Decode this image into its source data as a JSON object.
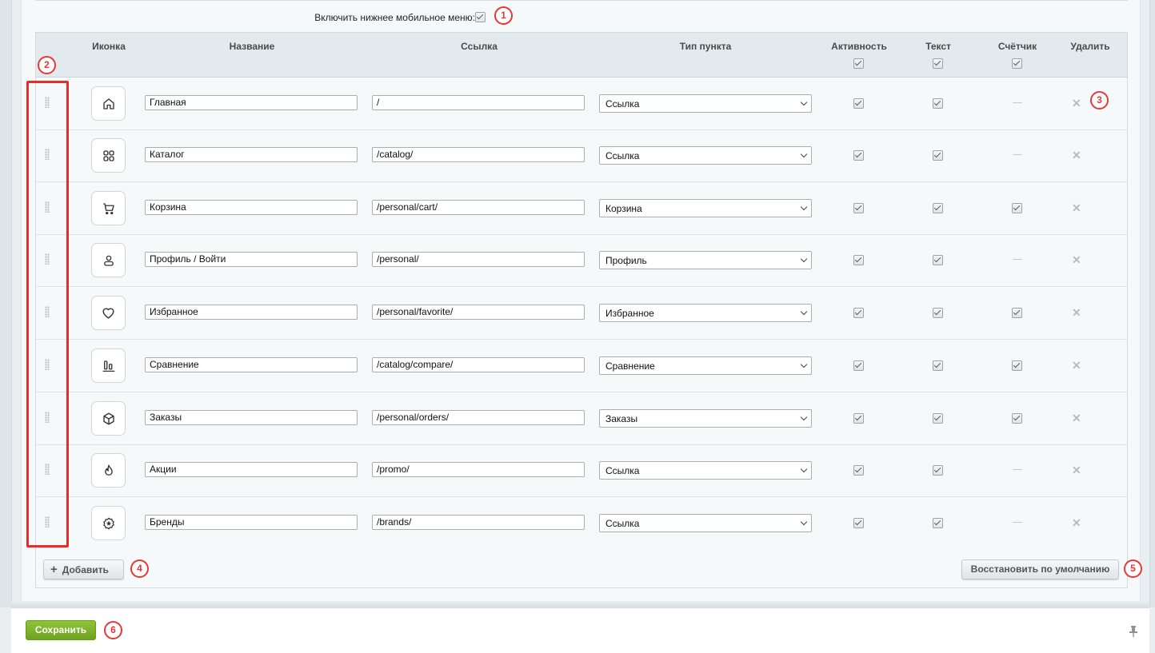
{
  "settings": {
    "enable_label": "Включить нижнее мобильное меню:",
    "enabled": true
  },
  "table": {
    "headers": {
      "icon": "Иконка",
      "name": "Название",
      "link": "Ссылка",
      "type": "Тип пункта",
      "active": "Активность",
      "text": "Текст",
      "counter": "Счётчик",
      "delete": "Удалить"
    },
    "rows": [
      {
        "icon": "home-icon",
        "name": "Главная",
        "link": "/",
        "type": "Ссылка",
        "active": true,
        "text": true,
        "counter": null
      },
      {
        "icon": "grid-icon",
        "name": "Каталог",
        "link": "/catalog/",
        "type": "Ссылка",
        "active": true,
        "text": true,
        "counter": null
      },
      {
        "icon": "cart-icon",
        "name": "Корзина",
        "link": "/personal/cart/",
        "type": "Корзина",
        "active": true,
        "text": true,
        "counter": true
      },
      {
        "icon": "user-icon",
        "name": "Профиль / Войти",
        "link": "/personal/",
        "type": "Профиль",
        "active": true,
        "text": true,
        "counter": null
      },
      {
        "icon": "heart-icon",
        "name": "Избранное",
        "link": "/personal/favorite/",
        "type": "Избранное",
        "active": true,
        "text": true,
        "counter": true
      },
      {
        "icon": "compare-icon",
        "name": "Сравнение",
        "link": "/catalog/compare/",
        "type": "Сравнение",
        "active": true,
        "text": true,
        "counter": true
      },
      {
        "icon": "box-icon",
        "name": "Заказы",
        "link": "/personal/orders/",
        "type": "Заказы",
        "active": true,
        "text": true,
        "counter": true
      },
      {
        "icon": "flame-icon",
        "name": "Акции",
        "link": "/promo/",
        "type": "Ссылка",
        "active": true,
        "text": true,
        "counter": null
      },
      {
        "icon": "star-badge-icon",
        "name": "Бренды",
        "link": "/brands/",
        "type": "Ссылка",
        "active": true,
        "text": true,
        "counter": null
      }
    ]
  },
  "buttons": {
    "add": "Добавить",
    "restore": "Восстановить по умолчанию",
    "save": "Сохранить"
  },
  "annotations": [
    "1",
    "2",
    "3",
    "4",
    "5",
    "6"
  ],
  "colors": {
    "annotation": "#e53935",
    "save_button": "#7bb12a"
  }
}
